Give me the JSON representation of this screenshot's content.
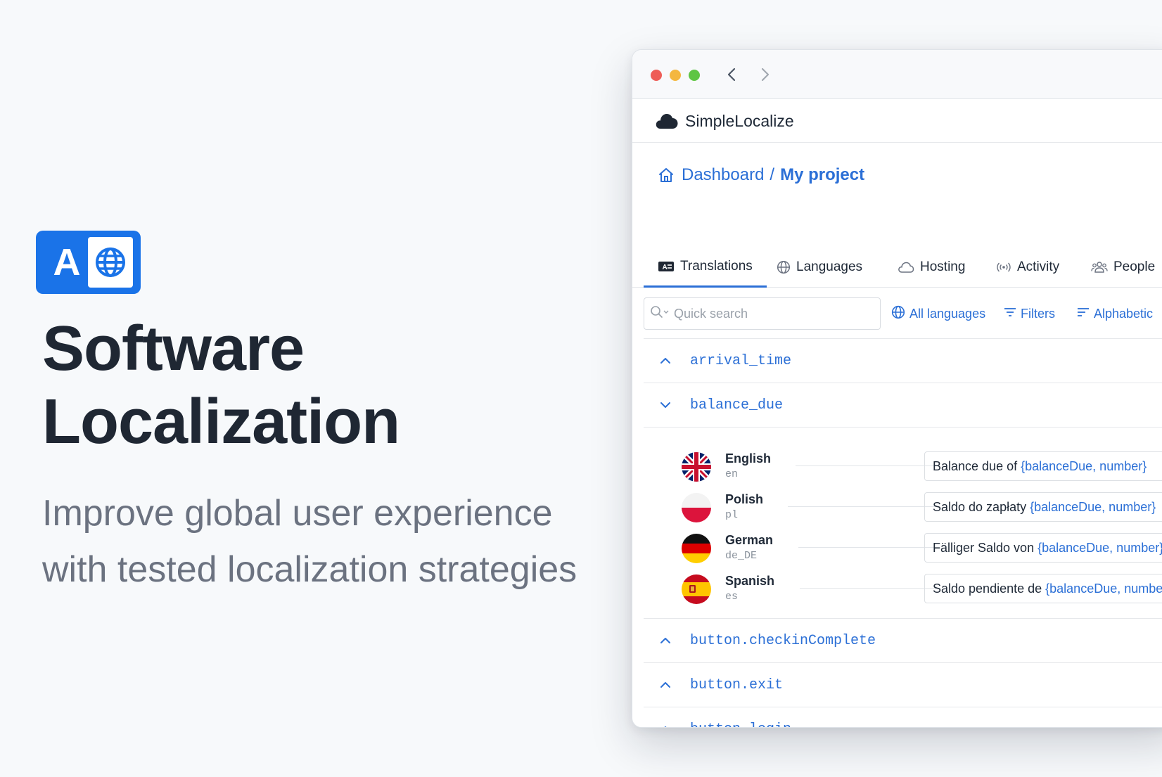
{
  "hero": {
    "logo_letter": "A",
    "title_line1": "Software",
    "title_line2": "Localization",
    "subtitle_line1": "Improve global user experience",
    "subtitle_line2": "with tested localization strategies"
  },
  "window": {
    "app_name": "SimpleLocalize",
    "breadcrumb": {
      "home": "Dashboard",
      "separator": "/",
      "current": "My project"
    },
    "tabs": [
      {
        "label": "Translations",
        "icon": "translations-icon",
        "active": true
      },
      {
        "label": "Languages",
        "icon": "globe-icon",
        "active": false
      },
      {
        "label": "Hosting",
        "icon": "cloud-icon",
        "active": false
      },
      {
        "label": "Activity",
        "icon": "broadcast-icon",
        "active": false
      },
      {
        "label": "People",
        "icon": "people-icon",
        "active": false
      }
    ],
    "toolbar": {
      "search_placeholder": "Quick search",
      "all_languages": "All languages",
      "filters": "Filters",
      "sort": "Alphabetic"
    },
    "keys": [
      {
        "name": "arrival_time",
        "expanded": false
      },
      {
        "name": "balance_due",
        "expanded": true
      },
      {
        "name": "button.checkinComplete",
        "expanded": false
      },
      {
        "name": "button.exit",
        "expanded": false
      },
      {
        "name": "button.login",
        "expanded": false
      }
    ],
    "translations": [
      {
        "language": "English",
        "code": "en",
        "text": "Balance due of",
        "variable": "{balanceDue, number}"
      },
      {
        "language": "Polish",
        "code": "pl",
        "text": "Saldo do zapłaty",
        "variable": "{balanceDue, number}"
      },
      {
        "language": "German",
        "code": "de_DE",
        "text": "Fälliger Saldo von",
        "variable": "{balanceDue, number}"
      },
      {
        "language": "Spanish",
        "code": "es",
        "text": "Saldo pendiente de",
        "variable": "{balanceDue, number}"
      }
    ]
  },
  "colors": {
    "accent": "#2b6fd6",
    "brand_badge": "#1a73e8",
    "title_text": "#1f2733",
    "subtitle_text": "#6b7280"
  }
}
